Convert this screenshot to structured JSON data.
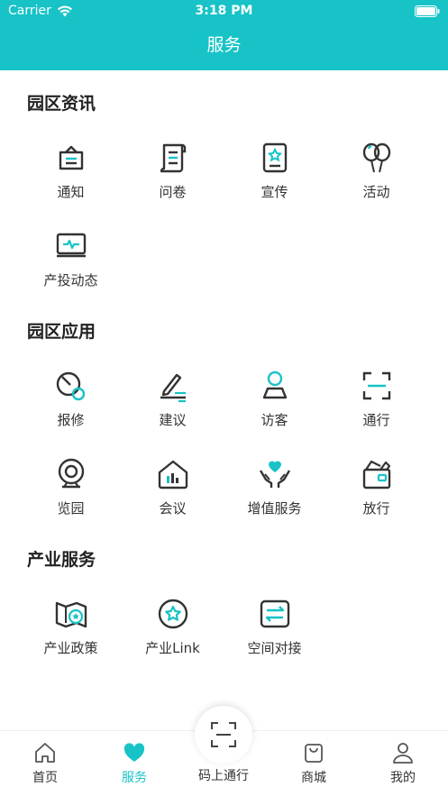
{
  "status_bar": {
    "carrier": "Carrier",
    "time": "3:18 PM"
  },
  "nav": {
    "title": "服务"
  },
  "sections": [
    {
      "title": "园区资讯",
      "items": [
        {
          "label": "通知",
          "icon": "notice-icon"
        },
        {
          "label": "问卷",
          "icon": "questionnaire-icon"
        },
        {
          "label": "宣传",
          "icon": "publicity-icon"
        },
        {
          "label": "活动",
          "icon": "balloon-icon"
        },
        {
          "label": "产投动态",
          "icon": "monitor-pulse-icon"
        }
      ]
    },
    {
      "title": "园区应用",
      "items": [
        {
          "label": "报修",
          "icon": "repair-icon"
        },
        {
          "label": "建议",
          "icon": "pen-icon"
        },
        {
          "label": "访客",
          "icon": "visitor-icon"
        },
        {
          "label": "通行",
          "icon": "scan-frame-icon"
        },
        {
          "label": "览园",
          "icon": "camera-icon"
        },
        {
          "label": "会议",
          "icon": "meeting-house-icon"
        },
        {
          "label": "增值服务",
          "icon": "hands-heart-icon"
        },
        {
          "label": "放行",
          "icon": "box-icon"
        }
      ]
    },
    {
      "title": "产业服务",
      "items": [
        {
          "label": "产业政策",
          "icon": "policy-map-icon"
        },
        {
          "label": "产业Link",
          "icon": "star-circle-icon"
        },
        {
          "label": "空间对接",
          "icon": "exchange-icon"
        }
      ]
    }
  ],
  "tab_bar": {
    "items": [
      {
        "label": "首页",
        "icon": "home-icon"
      },
      {
        "label": "服务",
        "icon": "heart-icon",
        "active": true
      },
      {
        "label": "码上通行",
        "icon": "scan-icon"
      },
      {
        "label": "商城",
        "icon": "bag-icon"
      },
      {
        "label": "我的",
        "icon": "user-icon"
      }
    ]
  },
  "colors": {
    "accent": "#17c3c7",
    "icon_dark": "#333333"
  }
}
